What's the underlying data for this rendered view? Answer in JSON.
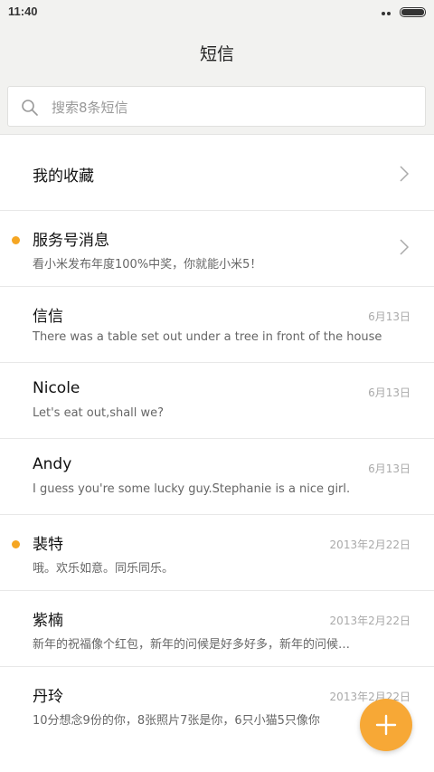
{
  "status_bar": {
    "time": "11:40"
  },
  "header": {
    "title": "短信"
  },
  "search": {
    "placeholder": "搜索8条短信"
  },
  "colors": {
    "accent": "#f7a836",
    "unread_dot": "#f5a623"
  },
  "conversations": [
    {
      "name": "我的收藏",
      "preview": "",
      "date": "",
      "unread": false,
      "chevron": true
    },
    {
      "name": "服务号消息",
      "preview": "看小米发布年度100%中奖，你就能小米5！",
      "date": "",
      "unread": true,
      "chevron": true
    },
    {
      "name": "信信",
      "preview": "There was a table set out under a tree in front of the house",
      "date": "6月13日",
      "unread": false,
      "chevron": false
    },
    {
      "name": "Nicole",
      "preview": "Let's eat out,shall we?",
      "date": "6月13日",
      "unread": false,
      "chevron": false
    },
    {
      "name": "Andy",
      "preview": "I guess you're some lucky guy.Stephanie is a nice girl.",
      "date": "6月13日",
      "unread": false,
      "chevron": false
    },
    {
      "name": "裴特",
      "preview": "哦。欢乐如意。同乐同乐。",
      "date": "2013年2月22日",
      "unread": true,
      "chevron": false
    },
    {
      "name": "紫楠",
      "preview": "新年的祝福像个红包，新年的问候是好多好多，新年的问候…",
      "date": "2013年2月22日",
      "unread": false,
      "chevron": false
    },
    {
      "name": "丹玲",
      "preview": "10分想念9份的你，8张照片7张是你，6只小猫5只像你",
      "date": "2013年2月22日",
      "unread": false,
      "chevron": false
    }
  ],
  "fab": {
    "icon": "plus-icon"
  }
}
